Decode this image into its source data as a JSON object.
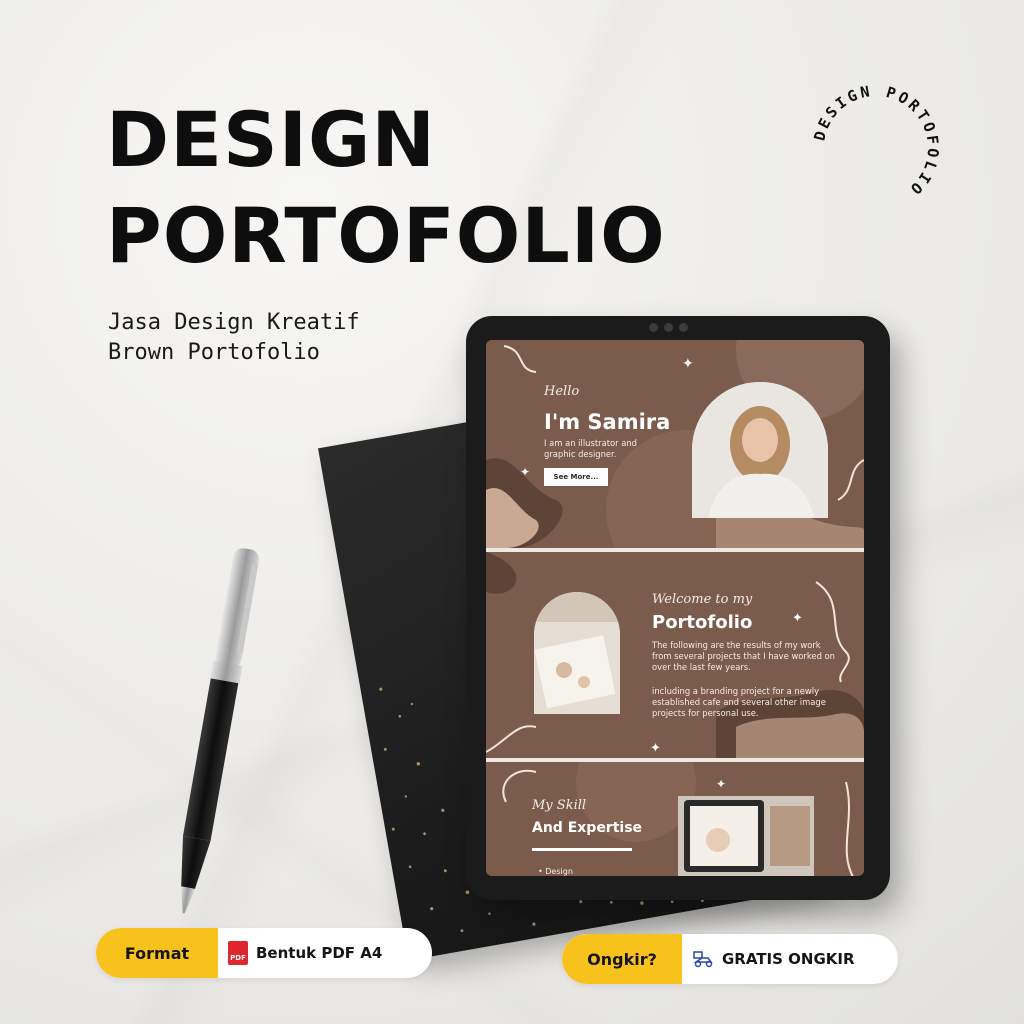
{
  "headline": {
    "line1": "DESIGN",
    "line2": "PORTOFOLIO"
  },
  "subtitle": {
    "line1": "Jasa Design Kreatif",
    "line2": "Brown Portofolio"
  },
  "badge": {
    "circle_text": "DESIGN PORTOFOLIO"
  },
  "colors": {
    "accent_yellow": "#f8c21d",
    "screen_brown": "#7b5b4c",
    "headline": "#0e0e0e"
  },
  "slide1": {
    "script": "Hello",
    "name": "I'm Samira",
    "description": "I am an illustrator and graphic designer.",
    "button_label": "See More..."
  },
  "slide2": {
    "script": "Welcome to my",
    "title": "Portofolio",
    "paragraph1": "The following are the results of my work from several projects that I have worked on over the last few years.",
    "paragraph2": "including a branding project for a newly established cafe and several other image projects for personal use."
  },
  "slide3": {
    "script": "My Skill",
    "title": "And Expertise",
    "items": [
      "Design"
    ]
  },
  "pills": {
    "format_label": "Format",
    "format_value": "Bentuk PDF A4",
    "format_icon": "pdf-icon",
    "pdf_icon_text": "PDF",
    "ongkir_label": "Ongkir?",
    "ongkir_value": "GRATIS ONGKIR",
    "ongkir_icon": "delivery-scooter-icon"
  }
}
